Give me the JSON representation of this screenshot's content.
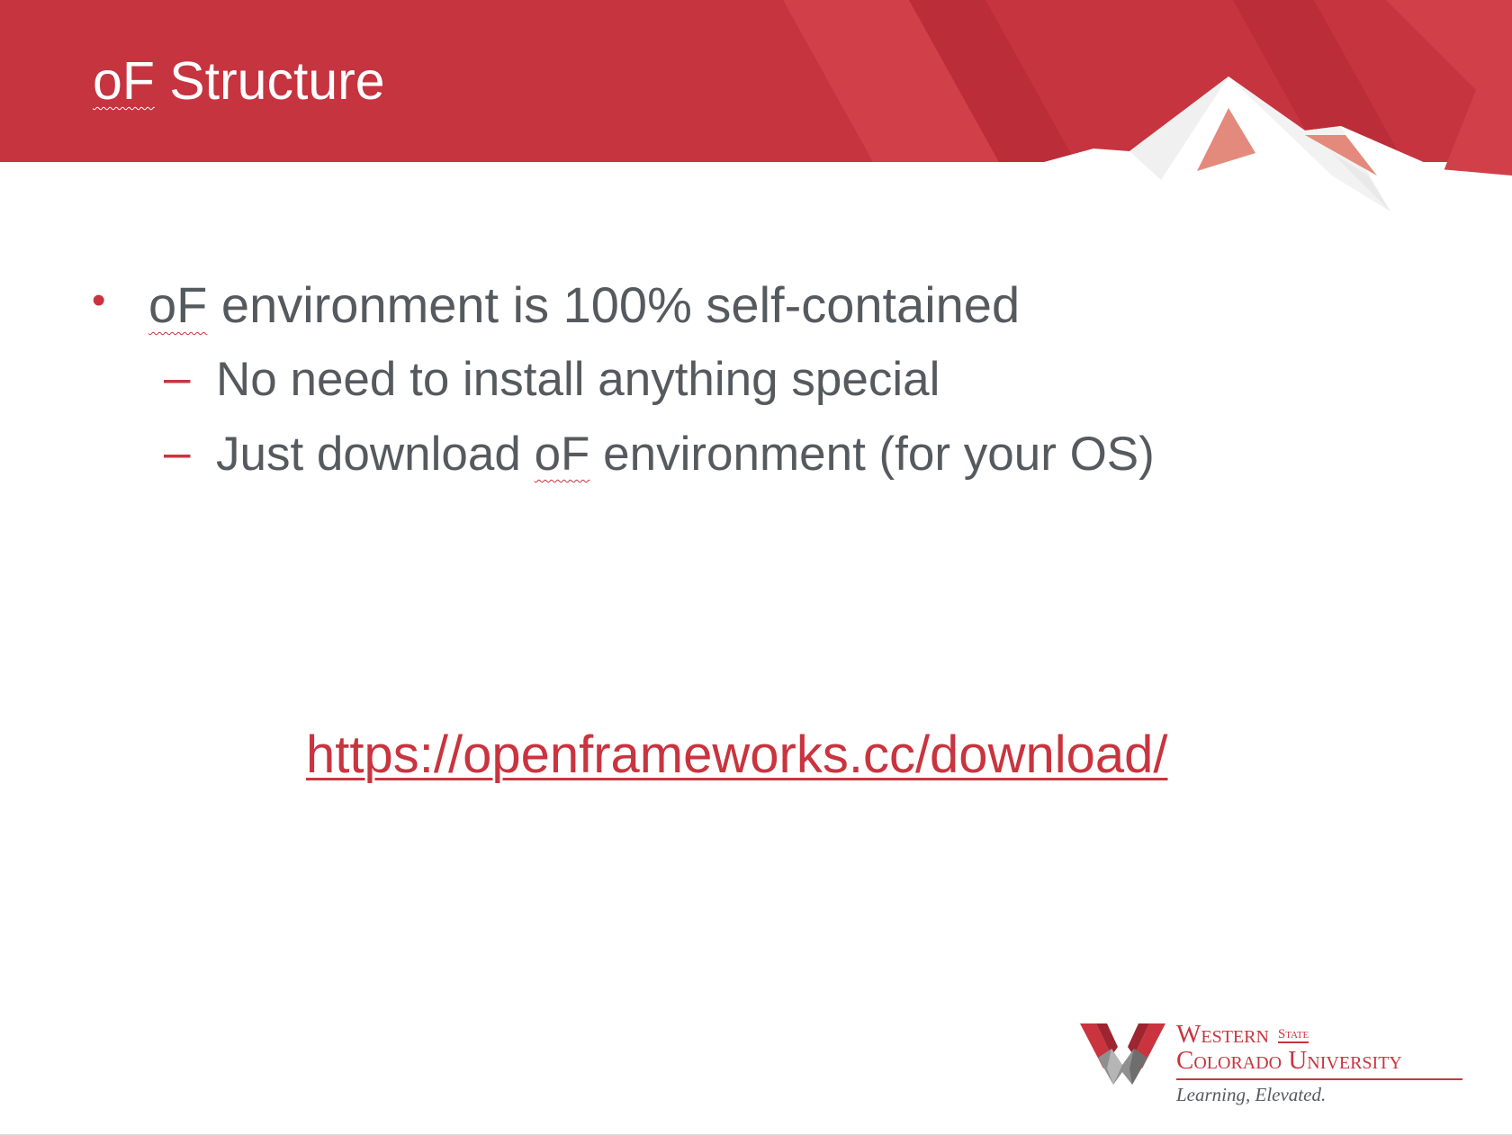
{
  "slide": {
    "title_prefix": "oF",
    "title_rest": " Structure",
    "bullets": [
      {
        "prefix": "oF",
        "text": " environment is 100% self-contained",
        "marker": "•"
      },
      {
        "text": "No need to install anything special",
        "marker": "–"
      },
      {
        "before": "Just download ",
        "prefix": "oF",
        "after": " environment (for your OS)",
        "marker": "–"
      }
    ],
    "link": "https://openframeworks.cc/download/"
  },
  "logo": {
    "line1": "Western",
    "state": "State",
    "line2": "Colorado University",
    "tagline": "Learning, Elevated."
  },
  "colors": {
    "accent": "#c9343f",
    "text": "#555a5f",
    "background": "#ffffff"
  }
}
